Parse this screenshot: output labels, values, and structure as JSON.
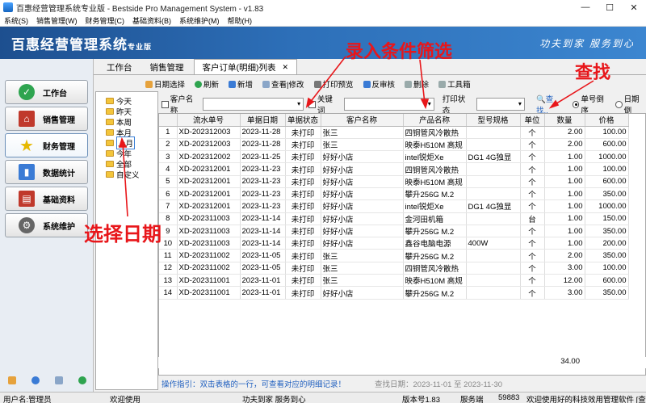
{
  "window": {
    "title": "百惠经营管理系统专业版 - Bestside Pro Management System - v1.83"
  },
  "menu": [
    "系统(S)",
    "销售管理(W)",
    "财务管理(C)",
    "基础资料(B)",
    "系统维护(M)",
    "帮助(H)"
  ],
  "banner": {
    "brand": "百惠经营管理系统",
    "brand_small": "专业版",
    "slogan": "功夫到家  服务到心"
  },
  "sidebar": [
    {
      "label": "工作台",
      "icon": "check-circle-icon",
      "color": "#2ea44f"
    },
    {
      "label": "销售管理",
      "icon": "house-icon",
      "color": "#c0392b"
    },
    {
      "label": "财务管理",
      "icon": "star-icon",
      "color": "#e6b800"
    },
    {
      "label": "数据统计",
      "icon": "bar-chart-icon",
      "color": "#3a7bd5"
    },
    {
      "label": "基础资料",
      "icon": "book-icon",
      "color": "#c0392b"
    },
    {
      "label": "系统维护",
      "icon": "gear-icon",
      "color": "#555555"
    }
  ],
  "tabs": [
    {
      "label": "工作台"
    },
    {
      "label": "销售管理"
    },
    {
      "label": "客户订单(明细)列表"
    }
  ],
  "toolbar": [
    "日期选择",
    "刷新",
    "新增",
    "查看|修改",
    "打印预览",
    "反审核",
    "删除",
    "工具箱"
  ],
  "date_tree": [
    "今天",
    "昨天",
    "本周",
    "本月",
    "上月",
    "今年",
    "全部",
    "自定义"
  ],
  "filter": {
    "customer_label": "客户名称",
    "keyword_label": "关键词",
    "print_state_label": "打印状态",
    "search_label": "查找..",
    "sort_desc_label": "单号倒序",
    "sort_date_label": "日期倒"
  },
  "table": {
    "headers": [
      "",
      "流水单号",
      "单据日期",
      "单据状态",
      "客户名称",
      "产品名称",
      "型号规格",
      "单位",
      "数量",
      "价格"
    ],
    "rows": [
      [
        "1",
        "XD-202312003",
        "2023-11-28",
        "未打印",
        "张三",
        "四铜管风冷散热",
        "",
        "个",
        "2.00",
        "100.00"
      ],
      [
        "2",
        "XD-202312003",
        "2023-11-28",
        "未打印",
        "张三",
        "映泰H510M 高规",
        "",
        "个",
        "2.00",
        "600.00"
      ],
      [
        "3",
        "XD-202312002",
        "2023-11-25",
        "未打印",
        "好好小店",
        "intel锐炬Xe",
        "DG1 4G独显",
        "个",
        "1.00",
        "1000.00"
      ],
      [
        "4",
        "XD-202312001",
        "2023-11-23",
        "未打印",
        "好好小店",
        "四铜管风冷散热",
        "",
        "个",
        "1.00",
        "100.00"
      ],
      [
        "5",
        "XD-202312001",
        "2023-11-23",
        "未打印",
        "好好小店",
        "映泰H510M 高规",
        "",
        "个",
        "1.00",
        "600.00"
      ],
      [
        "6",
        "XD-202312001",
        "2023-11-23",
        "未打印",
        "好好小店",
        "攀升256G M.2",
        "",
        "个",
        "1.00",
        "350.00"
      ],
      [
        "7",
        "XD-202312001",
        "2023-11-23",
        "未打印",
        "好好小店",
        "intel锐炬Xe",
        "DG1 4G独显",
        "个",
        "1.00",
        "1000.00"
      ],
      [
        "8",
        "XD-202311003",
        "2023-11-14",
        "未打印",
        "好好小店",
        "金河田机箱",
        "",
        "台",
        "1.00",
        "150.00"
      ],
      [
        "9",
        "XD-202311003",
        "2023-11-14",
        "未打印",
        "好好小店",
        "攀升256G M.2",
        "",
        "个",
        "1.00",
        "350.00"
      ],
      [
        "10",
        "XD-202311003",
        "2023-11-14",
        "未打印",
        "好好小店",
        "鑫谷电脑电源",
        "400W",
        "个",
        "1.00",
        "200.00"
      ],
      [
        "11",
        "XD-202311002",
        "2023-11-05",
        "未打印",
        "张三",
        "攀升256G M.2",
        "",
        "个",
        "2.00",
        "350.00"
      ],
      [
        "12",
        "XD-202311002",
        "2023-11-05",
        "未打印",
        "张三",
        "四铜管风冷散热",
        "",
        "个",
        "3.00",
        "100.00"
      ],
      [
        "13",
        "XD-202311001",
        "2023-11-01",
        "未打印",
        "张三",
        "映泰H510M 高规",
        "",
        "个",
        "12.00",
        "600.00"
      ],
      [
        "14",
        "XD-202311001",
        "2023-11-01",
        "未打印",
        "好好小店",
        "攀升256G M.2",
        "",
        "个",
        "3.00",
        "350.00"
      ]
    ],
    "total_qty": "34.00"
  },
  "hint": {
    "text": "操作指引：双击表格的一行，可查看对应的明细记录！",
    "range": "查找日期：2023-11-01 至 2023-11-30"
  },
  "status": {
    "user": "用户名:管理员",
    "welcome": "欢迎使用",
    "slogan": "功夫到家 服务到心",
    "version": "版本号1.83",
    "server": "服务端",
    "port": "59883",
    "tail": "欢迎使用好的科技效用管理软件 [查"
  },
  "annotations": {
    "filter_note": "录入条件筛选",
    "search_note": "查找",
    "date_note": "选择日期"
  }
}
